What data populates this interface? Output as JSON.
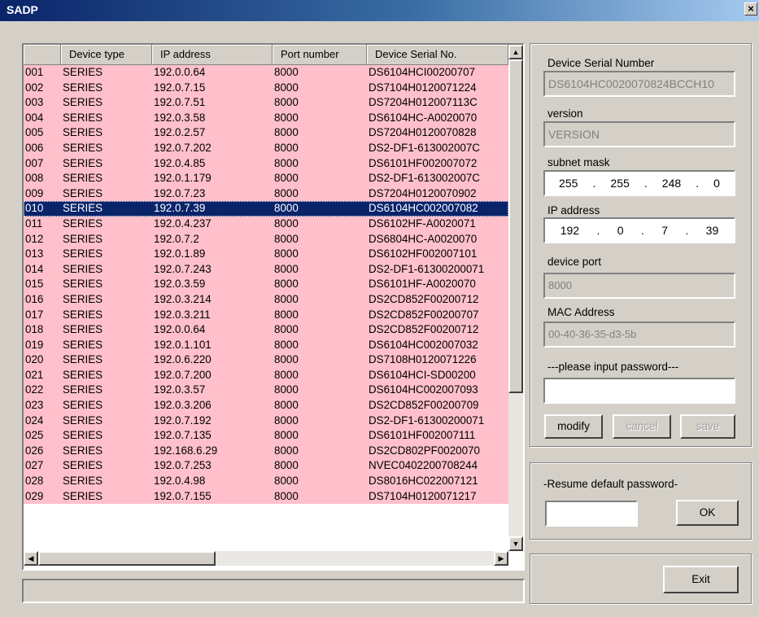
{
  "window": {
    "title": "SADP",
    "close_glyph": "×"
  },
  "table": {
    "columns": [
      "",
      "Device type",
      "IP address",
      "Port number",
      "Device Serial No."
    ],
    "rows": [
      [
        "001",
        "SERIES",
        "192.0.0.64",
        "8000",
        "DS6104HCI00200707"
      ],
      [
        "002",
        "SERIES",
        "192.0.7.15",
        "8000",
        "DS7104H0120071224"
      ],
      [
        "003",
        "SERIES",
        "192.0.7.51",
        "8000",
        "DS7204H012007113C"
      ],
      [
        "004",
        "SERIES",
        "192.0.3.58",
        "8000",
        "DS6104HC-A0020070"
      ],
      [
        "005",
        "SERIES",
        "192.0.2.57",
        "8000",
        "DS7204H0120070828"
      ],
      [
        "006",
        "SERIES",
        "192.0.7.202",
        "8000",
        "DS2-DF1-613002007C"
      ],
      [
        "007",
        "SERIES",
        "192.0.4.85",
        "8000",
        "DS6101HF002007072"
      ],
      [
        "008",
        "SERIES",
        "192.0.1.179",
        "8000",
        "DS2-DF1-613002007C"
      ],
      [
        "009",
        "SERIES",
        "192.0.7.23",
        "8000",
        "DS7204H0120070902"
      ],
      [
        "010",
        "SERIES",
        "192.0.7.39",
        "8000",
        "DS6104HC002007082"
      ],
      [
        "011",
        "SERIES",
        "192.0.4.237",
        "8000",
        "DS6102HF-A0020071"
      ],
      [
        "012",
        "SERIES",
        "192.0.7.2",
        "8000",
        "DS6804HC-A0020070"
      ],
      [
        "013",
        "SERIES",
        "192.0.1.89",
        "8000",
        "DS6102HF002007101"
      ],
      [
        "014",
        "SERIES",
        "192.0.7.243",
        "8000",
        "DS2-DF1-61300200071"
      ],
      [
        "015",
        "SERIES",
        "192.0.3.59",
        "8000",
        "DS6101HF-A0020070"
      ],
      [
        "016",
        "SERIES",
        "192.0.3.214",
        "8000",
        "DS2CD852F00200712"
      ],
      [
        "017",
        "SERIES",
        "192.0.3.211",
        "8000",
        "DS2CD852F00200707"
      ],
      [
        "018",
        "SERIES",
        "192.0.0.64",
        "8000",
        "DS2CD852F00200712"
      ],
      [
        "019",
        "SERIES",
        "192.0.1.101",
        "8000",
        "DS6104HC002007032"
      ],
      [
        "020",
        "SERIES",
        "192.0.6.220",
        "8000",
        "DS7108H0120071226"
      ],
      [
        "021",
        "SERIES",
        "192.0.7.200",
        "8000",
        "DS6104HCI-SD00200"
      ],
      [
        "022",
        "SERIES",
        "192.0.3.57",
        "8000",
        "DS6104HC002007093"
      ],
      [
        "023",
        "SERIES",
        "192.0.3.206",
        "8000",
        "DS2CD852F00200709"
      ],
      [
        "024",
        "SERIES",
        "192.0.7.192",
        "8000",
        "DS2-DF1-61300200071"
      ],
      [
        "025",
        "SERIES",
        "192.0.7.135",
        "8000",
        "DS6101HF002007111"
      ],
      [
        "026",
        "SERIES",
        "192.168.6.29",
        "8000",
        "DS2CD802PF0020070"
      ],
      [
        "027",
        "SERIES",
        "192.0.7.253",
        "8000",
        "NVEC0402200708244"
      ],
      [
        "028",
        "SERIES",
        "192.0.4.98",
        "8000",
        "DS8016HC022007121"
      ],
      [
        "029",
        "SERIES",
        "192.0.7.155",
        "8000",
        "DS7104H0120071217"
      ]
    ],
    "selected_index": 9
  },
  "scroll": {
    "up": "▲",
    "down": "▼",
    "left": "◀",
    "right": "▶"
  },
  "status_bar_text": "",
  "details": {
    "serial_label": "Device Serial Number",
    "serial_value": "DS6104HC0020070824BCCH10",
    "version_label": "version",
    "version_value": "VERSION",
    "subnet_label": "subnet mask",
    "subnet_octets": [
      "255",
      "255",
      "248",
      "0"
    ],
    "ip_label": "IP address",
    "ip_octets": [
      "192",
      "0",
      "7",
      "39"
    ],
    "port_label": "device port",
    "port_value": "8000",
    "mac_label": "MAC Address",
    "mac_value": "00-40-36-35-d3-5b",
    "password_label": "---please input password---",
    "password_value": "",
    "modify_label": "modify",
    "cancel_label": "cancel",
    "save_label": "save"
  },
  "resume": {
    "label": "-Resume default password-",
    "input_value": "",
    "ok_label": "OK"
  },
  "exit_label": "Exit"
}
